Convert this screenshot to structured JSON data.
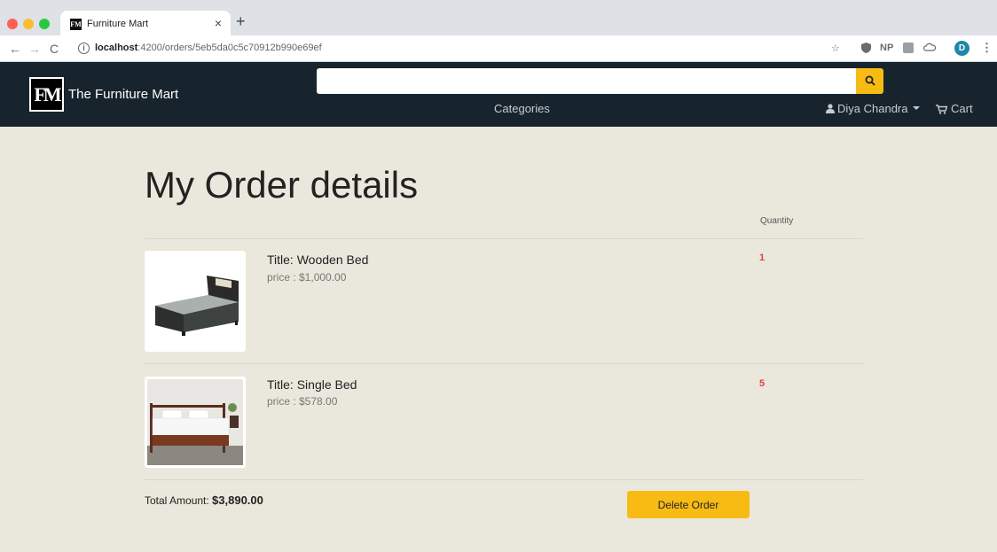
{
  "browser": {
    "tab_title": "Furniture Mart",
    "tab_favicon": "FM",
    "close_glyph": "×",
    "newtab_glyph": "+",
    "url_host": "localhost",
    "url_path": ":4200/orders/5eb5da0c5c70912b990e69ef",
    "profile_initial": "D",
    "extensions": [
      "star-icon",
      "shield-icon",
      "NP",
      "ext-icon",
      "cloud-icon"
    ]
  },
  "navbar": {
    "logo_text": "FM",
    "brand": "The Furniture Mart",
    "search": {
      "value": "",
      "placeholder": ""
    },
    "categories_label": "Categories",
    "user_name": "Diya Chandra",
    "cart_label": "Cart"
  },
  "order": {
    "title": "My Order details",
    "quantity_header": "Quantity",
    "items": [
      {
        "title": "Title: Wooden Bed",
        "price": "price : $1,000.00",
        "quantity": "1"
      },
      {
        "title": "Title: Single Bed",
        "price": "price : $578.00",
        "quantity": "5"
      }
    ],
    "total_label": "Total Amount: ",
    "total_value": "$3,890.00",
    "delete_label": "Delete Order"
  },
  "colors": {
    "navbar_bg": "#17242d",
    "page_bg": "#eae7dc",
    "accent": "#f8bb14",
    "quantity": "#d9453c"
  }
}
